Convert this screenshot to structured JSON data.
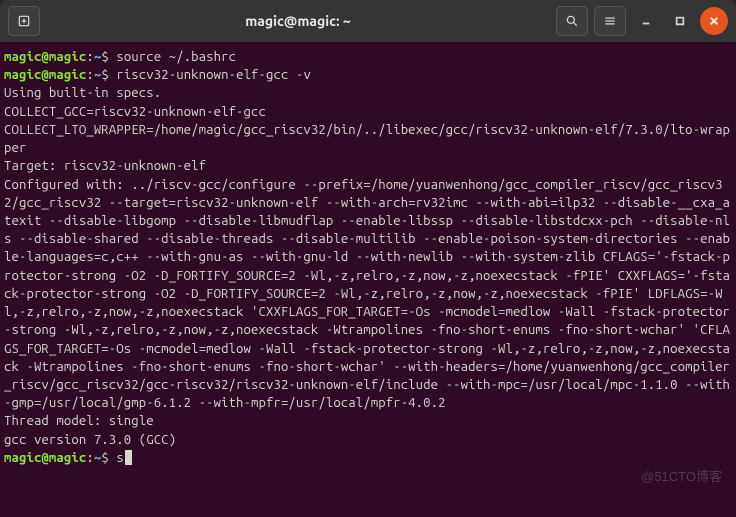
{
  "window": {
    "title": "magic@magic: ~"
  },
  "prompt": {
    "user_host": "magic@magic",
    "sep1": ":",
    "path": "~",
    "sep2": "$"
  },
  "lines": [
    {
      "kind": "cmd",
      "text": "source ~/.bashrc"
    },
    {
      "kind": "cmd",
      "text": "riscv32-unknown-elf-gcc -v"
    },
    {
      "kind": "out",
      "text": "Using built-in specs."
    },
    {
      "kind": "out",
      "text": "COLLECT_GCC=riscv32-unknown-elf-gcc"
    },
    {
      "kind": "out",
      "text": "COLLECT_LTO_WRAPPER=/home/magic/gcc_riscv32/bin/../libexec/gcc/riscv32-unknown-elf/7.3.0/lto-wrapper"
    },
    {
      "kind": "out",
      "text": "Target: riscv32-unknown-elf"
    },
    {
      "kind": "out",
      "text": "Configured with: ../riscv-gcc/configure --prefix=/home/yuanwenhong/gcc_compiler_riscv/gcc_riscv32/gcc_riscv32 --target=riscv32-unknown-elf --with-arch=rv32imc --with-abi=ilp32 --disable-__cxa_atexit --disable-libgomp --disable-libmudflap --enable-libssp --disable-libstdcxx-pch --disable-nls --disable-shared --disable-threads --disable-multilib --enable-poison-system-directories --enable-languages=c,c++ --with-gnu-as --with-gnu-ld --with-newlib --with-system-zlib CFLAGS='-fstack-protector-strong -O2 -D_FORTIFY_SOURCE=2 -Wl,-z,relro,-z,now,-z,noexecstack -fPIE' CXXFLAGS='-fstack-protector-strong -O2 -D_FORTIFY_SOURCE=2 -Wl,-z,relro,-z,now,-z,noexecstack -fPIE' LDFLAGS=-Wl,-z,relro,-z,now,-z,noexecstack 'CXXFLAGS_FOR_TARGET=-Os -mcmodel=medlow -Wall -fstack-protector-strong -Wl,-z,relro,-z,now,-z,noexecstack -Wtrampolines -fno-short-enums -fno-short-wchar' 'CFLAGS_FOR_TARGET=-Os -mcmodel=medlow -Wall -fstack-protector-strong -Wl,-z,relro,-z,now,-z,noexecstack -Wtrampolines -fno-short-enums -fno-short-wchar' --with-headers=/home/yuanwenhong/gcc_compiler_riscv/gcc_riscv32/gcc-riscv32/riscv32-unknown-elf/include --with-mpc=/usr/local/mpc-1.1.0 --with-gmp=/usr/local/gmp-6.1.2 --with-mpfr=/usr/local/mpfr-4.0.2"
    },
    {
      "kind": "out",
      "text": "Thread model: single"
    },
    {
      "kind": "out",
      "text": "gcc version 7.3.0 (GCC)"
    },
    {
      "kind": "cmd",
      "text": "s",
      "cursor": true
    }
  ],
  "watermark": "@51CTO博客"
}
